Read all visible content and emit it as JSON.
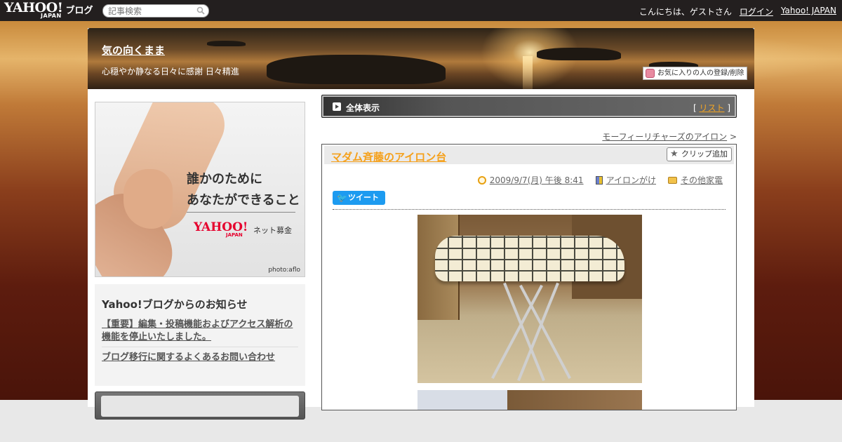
{
  "topbar": {
    "logo_text": "YAHOO!",
    "logo_sub": "JAPAN",
    "logo_blog": "ブログ",
    "search_placeholder": "記事検索",
    "greeting": "こんにちは、ゲストさん",
    "login": "ログイン",
    "yahoo_japan": "Yahoo! JAPAN"
  },
  "header": {
    "blog_title": "気の向くまま",
    "blog_subtitle": "心穏やか静なる日々に感謝 日々精進",
    "favorite_button": "お気に入りの人の登録/削除"
  },
  "sidebar": {
    "banner": {
      "line1": "誰かのために",
      "line2": "あなたができること",
      "brand": "YAHOO!",
      "brand_sub": "JAPAN",
      "service": "ネット募金",
      "credit": "photo:aflo"
    },
    "news": {
      "heading": "Yahoo!ブログからのお知らせ",
      "items": [
        "【重要】編集・投稿機能およびアクセス解析の機能を停止いたしました。",
        "ブログ移行に関するよくあるお問い合わせ"
      ]
    }
  },
  "main": {
    "all_view": "全体表示",
    "list_bracket_open": "[",
    "list_link": "リスト",
    "list_bracket_close": "]",
    "prev_link": "モーフィーリチャーズのアイロン",
    "prev_arrow": ">",
    "article": {
      "title": "マダム斉藤のアイロン台",
      "clip_button": "クリップ追加",
      "date": "2009/9/7(月) 午後 8:41",
      "category": "アイロンがけ",
      "folder": "その他家電",
      "tweet": "ツイート"
    }
  },
  "colors": {
    "topbar_bg": "#231f1f",
    "accent_orange": "#f5a01a",
    "tweet_blue": "#1d9bf0"
  }
}
